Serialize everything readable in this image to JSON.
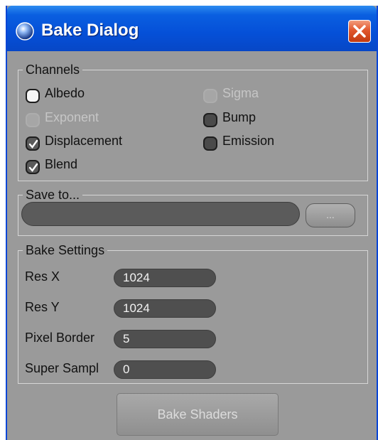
{
  "window": {
    "title": "Bake Dialog"
  },
  "channels": {
    "title": "Channels",
    "items": [
      {
        "label": "Albedo",
        "state": "unchecked",
        "enabled": true
      },
      {
        "label": "Sigma",
        "state": "unchecked",
        "enabled": false
      },
      {
        "label": "Exponent",
        "state": "unchecked",
        "enabled": false
      },
      {
        "label": "Bump",
        "state": "unchecked",
        "enabled": true
      },
      {
        "label": "Displacement",
        "state": "checked",
        "enabled": true
      },
      {
        "label": "Emission",
        "state": "unchecked",
        "enabled": true
      },
      {
        "label": "Blend",
        "state": "checked",
        "enabled": true
      }
    ]
  },
  "save_to": {
    "title": "Save to...",
    "path_value": "",
    "browse_label": "..."
  },
  "bake_settings": {
    "title": "Bake Settings",
    "fields": [
      {
        "label": "Res X",
        "value": "1024"
      },
      {
        "label": "Res Y",
        "value": "1024"
      },
      {
        "label": "Pixel Border",
        "value": "5"
      },
      {
        "label": "Super Sampl",
        "value": "0"
      }
    ]
  },
  "actions": {
    "bake_label": "Bake Shaders"
  },
  "colors": {
    "titlebar": "#0550d8",
    "panel": "#9a9a9a",
    "field": "#4f4f4f",
    "close": "#e1572d"
  }
}
